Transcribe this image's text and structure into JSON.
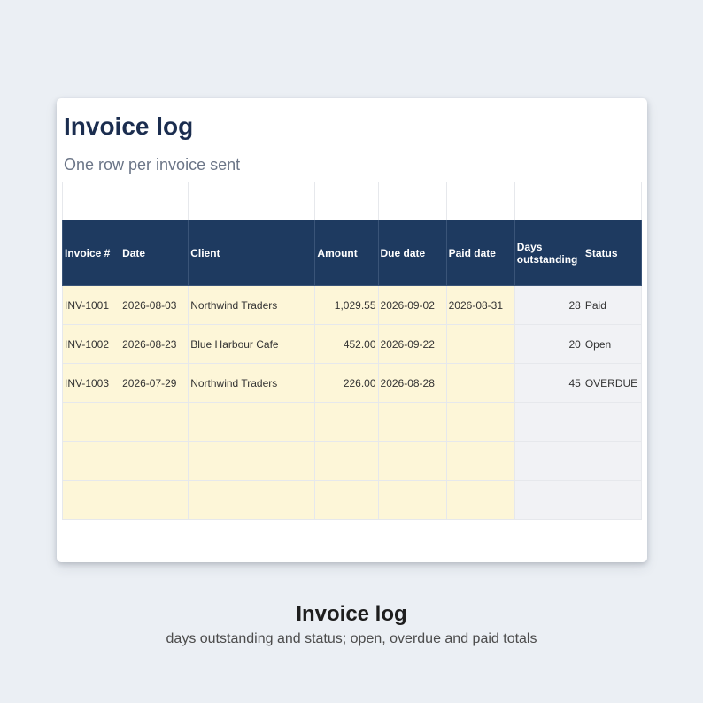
{
  "sheet": {
    "title": "Invoice log",
    "subtitle": "One row per invoice sent"
  },
  "table": {
    "headers": [
      "Invoice #",
      "Date",
      "Client",
      "Amount",
      "Due date",
      "Paid date",
      "Days outstanding",
      "Status"
    ],
    "rows": [
      [
        "INV-1001",
        "2026-08-03",
        "Northwind Traders",
        "1,029.55",
        "2026-09-02",
        "2026-08-31",
        "28",
        "Paid"
      ],
      [
        "INV-1002",
        "2026-08-23",
        "Blue Harbour Cafe",
        "452.00",
        "2026-09-22",
        "",
        "20",
        "Open"
      ],
      [
        "INV-1003",
        "2026-07-29",
        "Northwind Traders",
        "226.00",
        "2026-08-28",
        "",
        "45",
        "OVERDUE"
      ]
    ]
  },
  "caption": {
    "title": "Invoice log",
    "subtitle": "days outstanding and status; open, overdue and paid totals"
  },
  "colors": {
    "header_bg": "#1e3a60",
    "input_cell_bg": "#fdf6d8",
    "calc_cell_bg": "#f1f2f5",
    "title_color": "#1b2d4f",
    "page_bg": "#ebeff4"
  }
}
